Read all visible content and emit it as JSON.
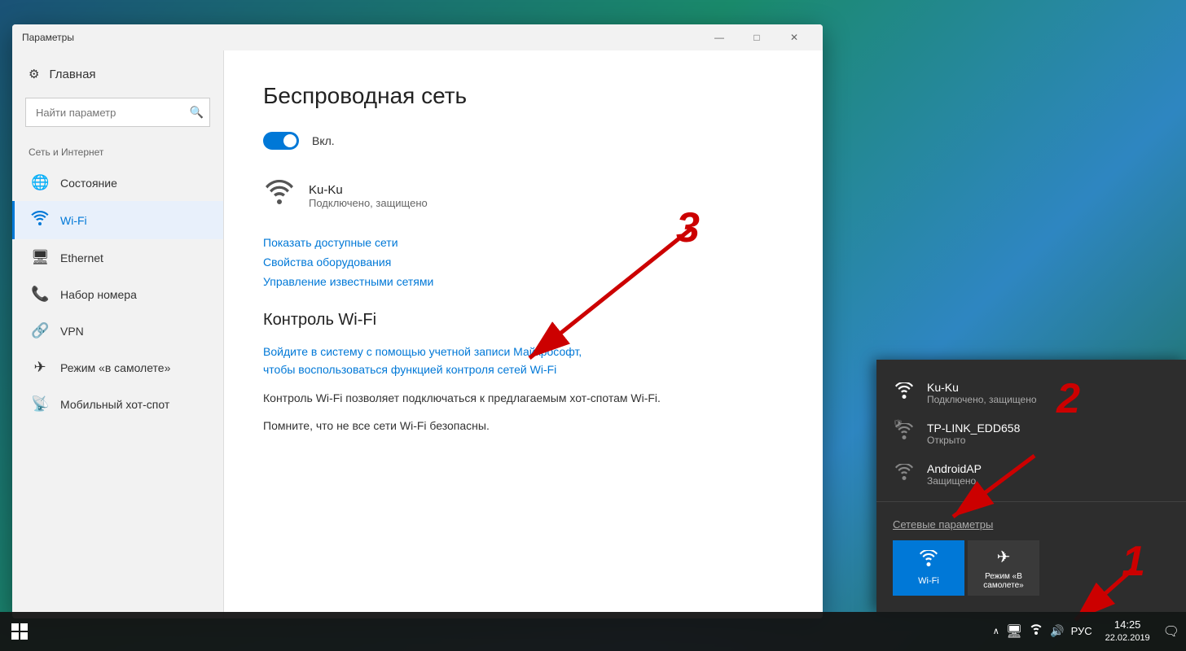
{
  "desktop": {
    "background": "gradient"
  },
  "window": {
    "title": "Параметры",
    "controls": {
      "minimize": "—",
      "maximize": "□",
      "close": "✕"
    }
  },
  "sidebar": {
    "home_label": "Главная",
    "search_placeholder": "Найти параметр",
    "section_label": "Сеть и Интернет",
    "items": [
      {
        "id": "status",
        "icon": "🌐",
        "label": "Состояние",
        "active": false
      },
      {
        "id": "wifi",
        "icon": "📶",
        "label": "Wi-Fi",
        "active": true
      },
      {
        "id": "ethernet",
        "icon": "🖥",
        "label": "Ethernet",
        "active": false
      },
      {
        "id": "dialup",
        "icon": "📞",
        "label": "Набор номера",
        "active": false
      },
      {
        "id": "vpn",
        "icon": "🔗",
        "label": "VPN",
        "active": false
      },
      {
        "id": "airplane",
        "icon": "✈",
        "label": "Режим «в самолете»",
        "active": false
      },
      {
        "id": "hotspot",
        "icon": "📡",
        "label": "Мобильный хот-спот",
        "active": false
      }
    ]
  },
  "main": {
    "title": "Беспроводная сеть",
    "toggle_label": "Вкл.",
    "connected_network": {
      "name": "Ku-Ku",
      "status": "Подключено, защищено"
    },
    "links": {
      "show_networks": "Показать доступные сети",
      "adapter_properties": "Свойства оборудования",
      "manage_known": "Управление известными сетями"
    },
    "wifi_control": {
      "subtitle": "Контроль Wi-Fi",
      "login_link": "Войдите в систему с помощью учетной записи Майкрософт,\nчтобы воспользоваться функцией контроля сетей Wi-Fi",
      "desc1": "Контроль Wi-Fi позволяет подключаться к предлагаемым хот-спотам Wi-Fi.",
      "desc2": "Помните, что не все сети Wi-Fi безопасны."
    }
  },
  "flyout": {
    "networks": [
      {
        "name": "Ku-Ku",
        "status": "Подключено, защищено",
        "icon": "wifi",
        "connected": true,
        "secure": false
      },
      {
        "name": "TP-LINK_EDD658",
        "status": "Открыто",
        "icon": "wifi-lock",
        "connected": false,
        "secure": false
      },
      {
        "name": "AndroidAP",
        "status": "Защищено",
        "icon": "wifi",
        "connected": false,
        "secure": true
      }
    ],
    "settings_link": "Сетевые параметры",
    "quick_actions": [
      {
        "id": "wifi",
        "label": "Wi-Fi",
        "active": true,
        "icon": "📶"
      },
      {
        "id": "airplane",
        "label": "Режим «В самолете»",
        "active": false,
        "icon": "✈"
      }
    ]
  },
  "taskbar": {
    "time": "14:25",
    "date": "22.02.2019",
    "language": "РУС"
  },
  "annotations": {
    "num1": "1",
    "num2": "2",
    "num3": "3"
  }
}
